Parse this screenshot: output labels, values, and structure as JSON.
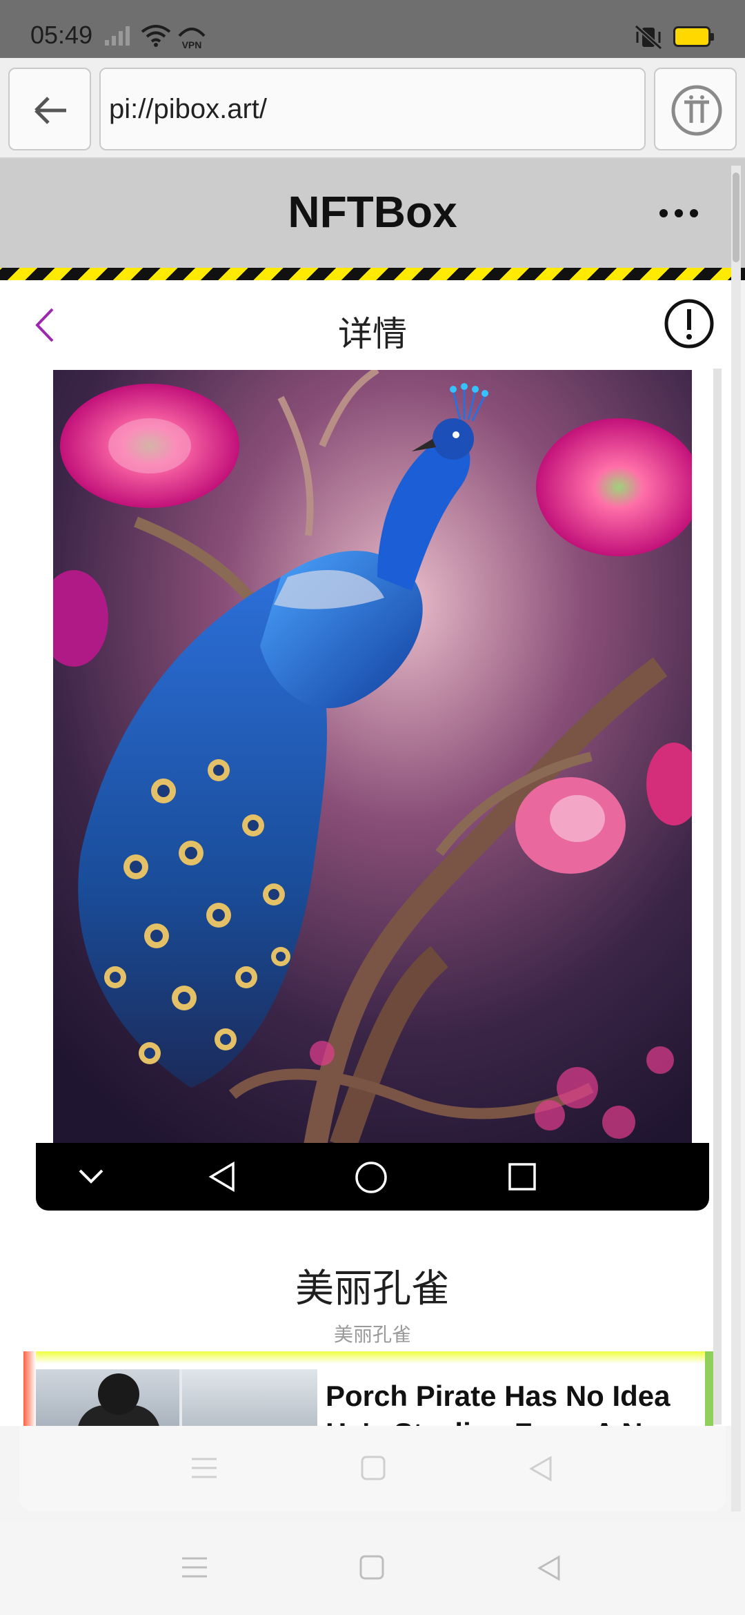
{
  "status_bar": {
    "time": "05:49",
    "vpn_label": "VPN",
    "icons": [
      "signal-icon",
      "wifi-icon",
      "vpn-icon",
      "vibrate-mute-icon",
      "battery-icon"
    ],
    "battery_color": "#ffd800"
  },
  "browser": {
    "url": "pi://pibox.art/",
    "back_icon": "arrow-left-icon",
    "pi_icon": "pi-logo-icon"
  },
  "app_header": {
    "title": "NFTBox",
    "menu_icon": "more-dots-icon",
    "hazard_colors": [
      "#111111",
      "#ffea00"
    ]
  },
  "page": {
    "title": "详情",
    "back_icon": "chevron-left-icon",
    "back_color": "#9c27b0",
    "info_icon": "info-alert-icon"
  },
  "nft": {
    "name": "美丽孔雀",
    "subtitle": "美丽孔雀",
    "image": "peacock-artwork"
  },
  "ad": {
    "headline": "Porch Pirate Has No Idea He's Stealing From A Navy"
  },
  "overlay_nav": {
    "icons": [
      "chevron-down-icon",
      "back-triangle-icon",
      "home-circle-icon",
      "recents-square-icon"
    ]
  },
  "page_nav": {
    "icons": [
      "menu-lines-icon",
      "home-square-icon",
      "back-triangle-icon"
    ]
  },
  "system_nav": {
    "icons": [
      "menu-lines-icon",
      "home-square-icon",
      "back-triangle-icon"
    ]
  }
}
